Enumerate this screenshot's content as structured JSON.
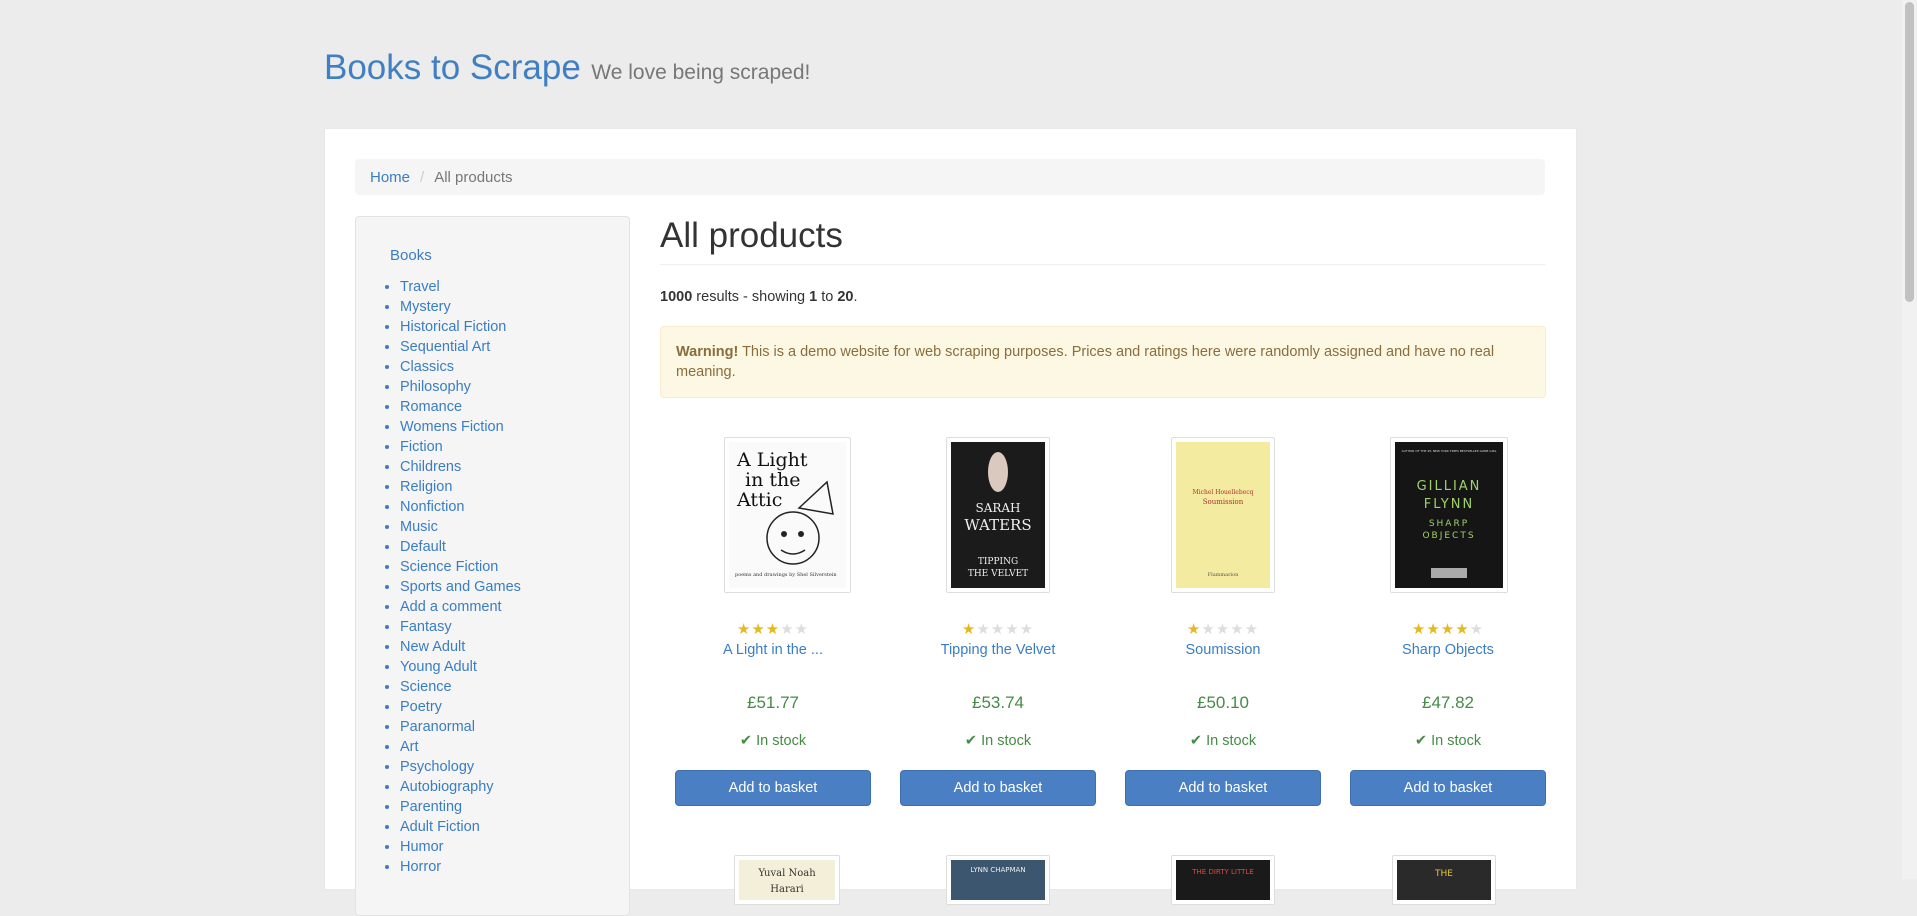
{
  "header": {
    "brand": "Books to Scrape",
    "tagline": "We love being scraped!"
  },
  "breadcrumb": {
    "home": "Home",
    "current": "All products"
  },
  "sidebar": {
    "top": "Books",
    "categories": [
      "Travel",
      "Mystery",
      "Historical Fiction",
      "Sequential Art",
      "Classics",
      "Philosophy",
      "Romance",
      "Womens Fiction",
      "Fiction",
      "Childrens",
      "Religion",
      "Nonfiction",
      "Music",
      "Default",
      "Science Fiction",
      "Sports and Games",
      "Add a comment",
      "Fantasy",
      "New Adult",
      "Young Adult",
      "Science",
      "Poetry",
      "Paranormal",
      "Art",
      "Psychology",
      "Autobiography",
      "Parenting",
      "Adult Fiction",
      "Humor",
      "Horror"
    ]
  },
  "main": {
    "title": "All products",
    "results": {
      "count": "1000",
      "mid": "results - showing",
      "from": "1",
      "to_word": "to",
      "to": "20",
      "end": "."
    },
    "warning": {
      "strong": "Warning!",
      "text": "This is a demo website for web scraping purposes. Prices and ratings here were randomly assigned and have no real meaning."
    }
  },
  "products": [
    {
      "title": "A Light in the ...",
      "price": "£51.77",
      "stock": "In stock",
      "rating": 3,
      "button": "Add to basket"
    },
    {
      "title": "Tipping the Velvet",
      "price": "£53.74",
      "stock": "In stock",
      "rating": 1,
      "button": "Add to basket"
    },
    {
      "title": "Soumission",
      "price": "£50.10",
      "stock": "In stock",
      "rating": 1,
      "button": "Add to basket"
    },
    {
      "title": "Sharp Objects",
      "price": "£47.82",
      "stock": "In stock",
      "rating": 4,
      "button": "Add to basket"
    }
  ],
  "covers": {
    "p0": {
      "line1": "A Light",
      "line2": "in the",
      "line3": "Attic",
      "credit": "poems and drawings by Shel Silverstein"
    },
    "p1": {
      "author1": "SARAH",
      "author2": "WATERS",
      "title1": "TIPPING",
      "title2": "THE VELVET"
    },
    "p2": {
      "author": "Michel Houellebecq",
      "title": "Soumission",
      "publisher": "Flammarion"
    },
    "p3": {
      "top": "AUTHOR OF THE #1 NEW YORK TIMES BESTSELLER GONE GIRL",
      "author1": "GILLIAN",
      "author2": "FLYNN",
      "title1": "SHARP",
      "title2": "OBJECTS"
    },
    "p4": {
      "author1": "Yuval Noah",
      "author2": "Harari"
    },
    "p5": {
      "author": "LYNN CHAPMAN"
    },
    "p6": {
      "title": "THE DIRTY LITTLE"
    },
    "p7": {
      "title": "THE"
    }
  },
  "colors": {
    "link": "#3a7dc4",
    "price": "#458b45",
    "button": "#4a7fc4",
    "warning_bg": "#fcf8e3",
    "star_on": "#e6b91e"
  }
}
